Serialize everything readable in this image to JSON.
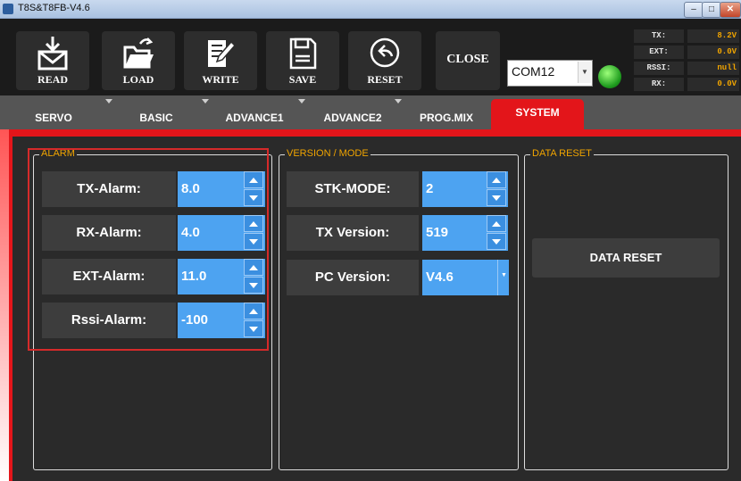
{
  "window": {
    "title": "T8S&T8FB-V4.6"
  },
  "toolbar": {
    "read": "READ",
    "load": "LOAD",
    "write": "WRITE",
    "save": "SAVE",
    "reset": "RESET",
    "close": "CLOSE",
    "port": "COM12",
    "connection_status_color": "#2cb52c",
    "icons": [
      "envelope-download-icon",
      "folder-open-icon",
      "write-pencil-icon",
      "floppy-disk-icon",
      "reset-arrow-icon"
    ]
  },
  "status": [
    {
      "label": "TX:",
      "value": "8.2V"
    },
    {
      "label": "EXT:",
      "value": "0.0V"
    },
    {
      "label": "RSSI:",
      "value": "null"
    },
    {
      "label": "RX:",
      "value": "0.0V"
    }
  ],
  "tabs": [
    "SERVO",
    "BASIC",
    "ADVANCE1",
    "ADVANCE2",
    "PROG.MIX",
    "SYSTEM"
  ],
  "active_tab": "SYSTEM",
  "accent_color": "#e3151a",
  "value_color": "#4da3f1",
  "alarm": {
    "title": "ALARM",
    "fields": [
      {
        "label": "TX-Alarm:",
        "value": "8.0"
      },
      {
        "label": "RX-Alarm:",
        "value": "4.0"
      },
      {
        "label": "EXT-Alarm:",
        "value": "11.0"
      },
      {
        "label": "Rssi-Alarm:",
        "value": "-100"
      }
    ]
  },
  "version": {
    "title": "VERSION / MODE",
    "fields": [
      {
        "label": "STK-MODE:",
        "value": "2"
      },
      {
        "label": "TX Version:",
        "value": "519"
      },
      {
        "label": "PC Version:",
        "value": "V4.6"
      }
    ]
  },
  "data_reset": {
    "title": "DATA RESET",
    "button": "DATA RESET"
  }
}
